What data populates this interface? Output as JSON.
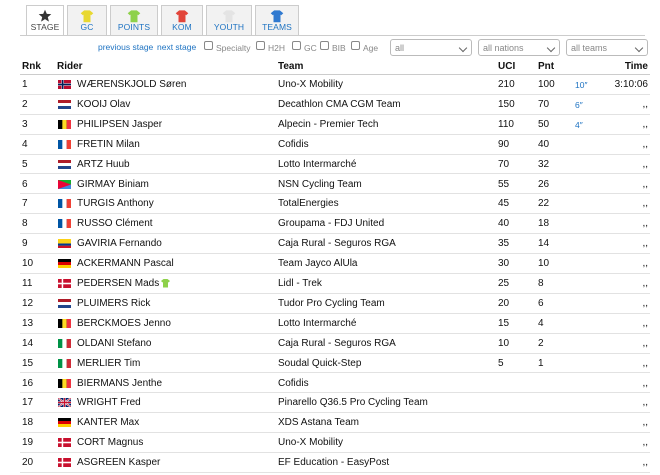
{
  "tabs": [
    {
      "label": "STAGE",
      "icon": "star-icon",
      "color": "#333333",
      "active": true
    },
    {
      "label": "GC",
      "icon": "yellow-jersey-icon",
      "color": "#e8d830",
      "active": false
    },
    {
      "label": "POINTS",
      "icon": "green-jersey-icon",
      "color": "#8ed14a",
      "active": false
    },
    {
      "label": "KOM",
      "icon": "red-jersey-icon",
      "color": "#e2453a",
      "active": false
    },
    {
      "label": "YOUTH",
      "icon": "white-jersey-icon",
      "color": "#dddddd",
      "active": false
    },
    {
      "label": "TEAMS",
      "icon": "blue-jersey-icon",
      "color": "#2f79d0",
      "active": false
    }
  ],
  "filters": {
    "previous_stage": "previous stage",
    "next_stage": "next stage",
    "checkboxes": [
      "Specialty",
      "H2H",
      "GC",
      "BIB",
      "Age"
    ],
    "selects": [
      "all",
      "all nations",
      "all teams"
    ]
  },
  "table": {
    "headers": {
      "rnk": "Rnk",
      "rider": "Rider",
      "team": "Team",
      "uci": "UCI",
      "pnt": "Pnt",
      "time": "Time"
    },
    "rows": [
      {
        "rnk": "1",
        "flag": "no",
        "rider": "WÆRENSKJOLD Søren",
        "team": "Uno-X Mobility",
        "uci": "210",
        "pnt": "100",
        "bonus": "10″",
        "time": "3:10:06"
      },
      {
        "rnk": "2",
        "flag": "nl",
        "rider": "KOOIJ Olav",
        "team": "Decathlon CMA CGM Team",
        "uci": "150",
        "pnt": "70",
        "bonus": "6″",
        "time": ",,"
      },
      {
        "rnk": "3",
        "flag": "be",
        "rider": "PHILIPSEN Jasper",
        "team": "Alpecin - Premier Tech",
        "uci": "110",
        "pnt": "50",
        "bonus": "4″",
        "time": ",,"
      },
      {
        "rnk": "4",
        "flag": "fr",
        "rider": "FRETIN Milan",
        "team": "Cofidis",
        "uci": "90",
        "pnt": "40",
        "bonus": "",
        "time": ",,"
      },
      {
        "rnk": "5",
        "flag": "nl",
        "rider": "ARTZ Huub",
        "team": "Lotto Intermarché",
        "uci": "70",
        "pnt": "32",
        "bonus": "",
        "time": ",,"
      },
      {
        "rnk": "6",
        "flag": "er",
        "rider": "GIRMAY Biniam",
        "team": "NSN Cycling Team",
        "uci": "55",
        "pnt": "26",
        "bonus": "",
        "time": ",,"
      },
      {
        "rnk": "7",
        "flag": "fr",
        "rider": "TURGIS Anthony",
        "team": "TotalEnergies",
        "uci": "45",
        "pnt": "22",
        "bonus": "",
        "time": ",,"
      },
      {
        "rnk": "8",
        "flag": "fr",
        "rider": "RUSSO Clément",
        "team": "Groupama - FDJ United",
        "uci": "40",
        "pnt": "18",
        "bonus": "",
        "time": ",,"
      },
      {
        "rnk": "9",
        "flag": "co",
        "rider": "GAVIRIA Fernando",
        "team": "Caja Rural - Seguros RGA",
        "uci": "35",
        "pnt": "14",
        "bonus": "",
        "time": ",,"
      },
      {
        "rnk": "10",
        "flag": "de",
        "rider": "ACKERMANN Pascal",
        "team": "Team Jayco AlUla",
        "uci": "30",
        "pnt": "10",
        "bonus": "",
        "time": ",,"
      },
      {
        "rnk": "11",
        "flag": "dk",
        "rider": "PEDERSEN Mads",
        "jersey": "#8ed14a",
        "team": "Lidl - Trek",
        "uci": "25",
        "pnt": "8",
        "bonus": "",
        "time": ",,"
      },
      {
        "rnk": "12",
        "flag": "nl",
        "rider": "PLUIMERS Rick",
        "team": "Tudor Pro Cycling Team",
        "uci": "20",
        "pnt": "6",
        "bonus": "",
        "time": ",,"
      },
      {
        "rnk": "13",
        "flag": "be",
        "rider": "BERCKMOES Jenno",
        "team": "Lotto Intermarché",
        "uci": "15",
        "pnt": "4",
        "bonus": "",
        "time": ",,"
      },
      {
        "rnk": "14",
        "flag": "it",
        "rider": "OLDANI Stefano",
        "team": "Caja Rural - Seguros RGA",
        "uci": "10",
        "pnt": "2",
        "bonus": "",
        "time": ",,"
      },
      {
        "rnk": "15",
        "flag": "it",
        "rider": "MERLIER Tim",
        "team": "Soudal Quick-Step",
        "uci": "5",
        "pnt": "1",
        "bonus": "",
        "time": ",,"
      },
      {
        "rnk": "16",
        "flag": "be",
        "rider": "BIERMANS Jenthe",
        "team": "Cofidis",
        "uci": "",
        "pnt": "",
        "bonus": "",
        "time": ",,"
      },
      {
        "rnk": "17",
        "flag": "gb",
        "rider": "WRIGHT Fred",
        "team": "Pinarello Q36.5 Pro Cycling Team",
        "uci": "",
        "pnt": "",
        "bonus": "",
        "time": ",,"
      },
      {
        "rnk": "18",
        "flag": "de",
        "rider": "KANTER Max",
        "team": "XDS Astana Team",
        "uci": "",
        "pnt": "",
        "bonus": "",
        "time": ",,"
      },
      {
        "rnk": "19",
        "flag": "dk",
        "rider": "CORT Magnus",
        "team": "Uno-X Mobility",
        "uci": "",
        "pnt": "",
        "bonus": "",
        "time": ",,"
      },
      {
        "rnk": "20",
        "flag": "dk",
        "rider": "ASGREEN Kasper",
        "team": "EF Education - EasyPost",
        "uci": "",
        "pnt": "",
        "bonus": "",
        "time": ",,"
      }
    ]
  }
}
